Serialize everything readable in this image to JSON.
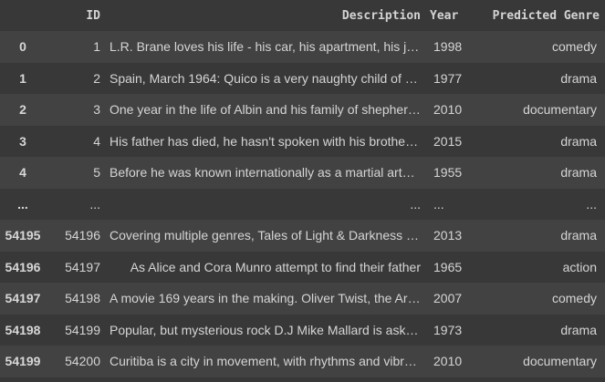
{
  "table": {
    "columns": [
      "",
      "ID",
      "Description",
      "Year",
      "Predicted Genre"
    ],
    "rows": [
      {
        "index": "0",
        "id": "1",
        "description": "L.R. Brane loves his life - his car, his apartment, his job, but especially his girlfriend",
        "year": "1998",
        "genre": "comedy"
      },
      {
        "index": "1",
        "id": "2",
        "description": "Spain, March 1964: Quico is a very naughty child of three",
        "year": "1977",
        "genre": "drama"
      },
      {
        "index": "2",
        "id": "3",
        "description": "One year in the life of Albin and his family of shepherds",
        "year": "2010",
        "genre": "documentary"
      },
      {
        "index": "3",
        "id": "4",
        "description": "His father has died, he hasn't spoken with his brother for about ten years",
        "year": "2015",
        "genre": "drama"
      },
      {
        "index": "4",
        "id": "5",
        "description": "Before he was known internationally as a martial arts superstar",
        "year": "1955",
        "genre": "drama"
      },
      {
        "index": "...",
        "id": "...",
        "description": "...",
        "year": "...",
        "genre": "..."
      },
      {
        "index": "54195",
        "id": "54196",
        "description": "Covering multiple genres, Tales of Light & Darkness is an anthology",
        "year": "2013",
        "genre": "drama"
      },
      {
        "index": "54196",
        "id": "54197",
        "description": "As Alice and Cora Munro attempt to find their father",
        "year": "1965",
        "genre": "action"
      },
      {
        "index": "54197",
        "id": "54198",
        "description": "A movie 169 years in the making. Oliver Twist, the Artful Dodger",
        "year": "2007",
        "genre": "comedy"
      },
      {
        "index": "54198",
        "id": "54199",
        "description": "Popular, but mysterious rock D.J Mike Mallard is askew",
        "year": "1973",
        "genre": "drama"
      },
      {
        "index": "54199",
        "id": "54200",
        "description": "Curitiba is a city in movement, with rhythms and vibrations",
        "year": "2010",
        "genre": "documentary"
      }
    ]
  }
}
